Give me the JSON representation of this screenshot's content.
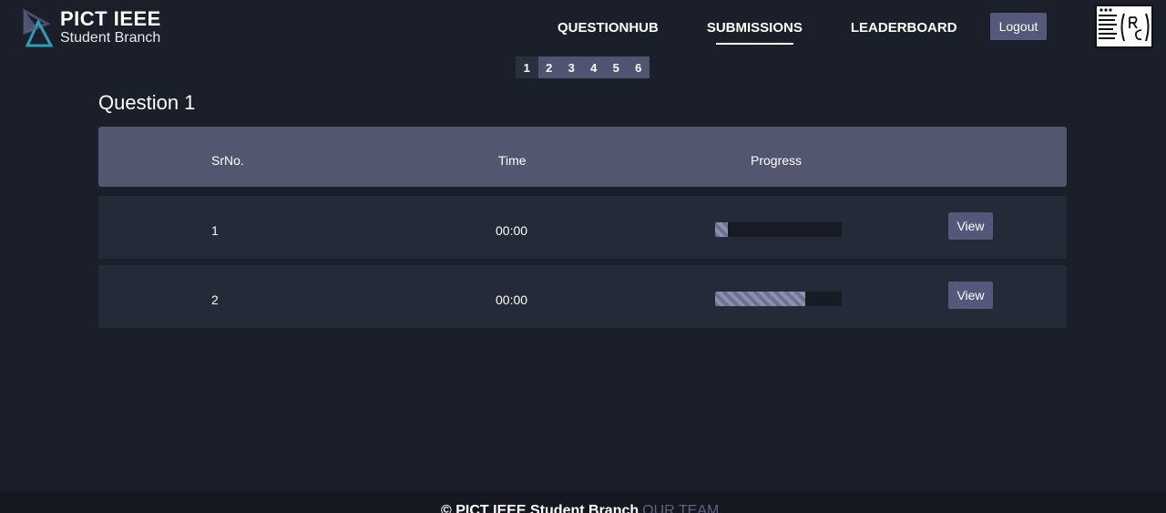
{
  "brand": {
    "title": "PICT IEEE",
    "subtitle": "Student Branch"
  },
  "nav": {
    "items": [
      {
        "label": "QUESTIONHUB"
      },
      {
        "label": "SUBMISSIONS"
      },
      {
        "label": "LEADERBOARD"
      }
    ],
    "active": "SUBMISSIONS",
    "logout_label": "Logout"
  },
  "pagination": {
    "pages": [
      "1",
      "2",
      "3",
      "4",
      "5",
      "6"
    ],
    "current": "1"
  },
  "question": {
    "title": "Question 1"
  },
  "table": {
    "headers": {
      "srno": "SrNo.",
      "time": "Time",
      "progress": "Progress"
    },
    "rows": [
      {
        "srno": "1",
        "time": "00:00",
        "progress": 0.1,
        "action": "View"
      },
      {
        "srno": "2",
        "time": "00:00",
        "progress": 0.71,
        "action": "View"
      }
    ]
  },
  "footer": {
    "text": "© PICT IEEE Student Branch",
    "link": "OUR TEAM"
  },
  "colors": {
    "background": "#1b1f29",
    "header_row": "#53566f",
    "row": "#242a38",
    "button": "#54587a"
  }
}
